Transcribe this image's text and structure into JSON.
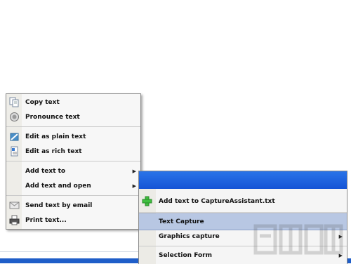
{
  "context_menu": {
    "items": [
      {
        "label": "Copy text",
        "icon": "copy-icon"
      },
      {
        "label": "Pronounce text",
        "icon": "speaker-icon"
      },
      {
        "label": "Edit as plain text",
        "icon": "edit-plain-icon"
      },
      {
        "label": "Edit as rich text",
        "icon": "edit-rich-icon"
      },
      {
        "label": "Add text to",
        "has_submenu": true
      },
      {
        "label": "Add text and open",
        "has_submenu": true
      },
      {
        "label": "Send text by email",
        "icon": "envelope-icon"
      },
      {
        "label": "Print text...",
        "icon": "printer-icon"
      }
    ]
  },
  "capture_menu": {
    "items": [
      {
        "label": "Add text to CaptureAssistant.txt",
        "icon": "plus-icon"
      },
      {
        "label": "Text Capture",
        "highlighted": true
      },
      {
        "label": "Graphics capture",
        "has_submenu": true
      },
      {
        "label": "Selection Form",
        "has_submenu": true
      }
    ]
  },
  "colors": {
    "title_bar": "#1f5fd8",
    "highlight": "#b8c7e3",
    "taskbar": "#1f5ec9"
  }
}
